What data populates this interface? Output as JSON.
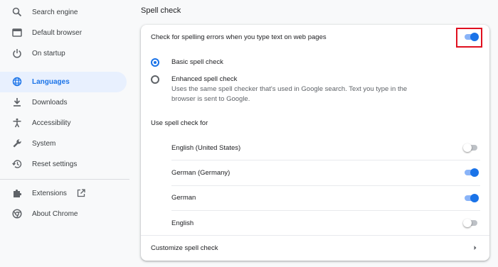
{
  "sidebar": {
    "items": [
      {
        "label": "Search engine",
        "icon": "search-icon"
      },
      {
        "label": "Default browser",
        "icon": "browser-window-icon"
      },
      {
        "label": "On startup",
        "icon": "power-icon"
      },
      {
        "label": "Languages",
        "icon": "globe-icon",
        "active": true
      },
      {
        "label": "Downloads",
        "icon": "download-icon"
      },
      {
        "label": "Accessibility",
        "icon": "accessibility-icon"
      },
      {
        "label": "System",
        "icon": "wrench-icon"
      },
      {
        "label": "Reset settings",
        "icon": "restore-icon"
      }
    ],
    "extra": [
      {
        "label": "Extensions",
        "icon": "puzzle-icon"
      },
      {
        "label": "About Chrome",
        "icon": "chrome-icon"
      }
    ]
  },
  "spell": {
    "title": "Spell check",
    "main_toggle_label": "Check for spelling errors when you type text on web pages",
    "main_toggle_on": true,
    "basic_label": "Basic spell check",
    "enhanced_label": "Enhanced spell check",
    "enhanced_desc_1": "Uses the same spell checker that's used in Google search. Text you type in the",
    "enhanced_desc_2": "browser is sent to Google.",
    "use_for_label": "Use spell check for",
    "languages": [
      {
        "name": "English (United States)",
        "enabled": false
      },
      {
        "name": "German (Germany)",
        "enabled": true
      },
      {
        "name": "German",
        "enabled": true
      },
      {
        "name": "English",
        "enabled": false
      }
    ],
    "customize_label": "Customize spell check"
  },
  "colors": {
    "accent": "#1a73e8",
    "active_bg": "#e8f0fe",
    "highlight_border": "#e0101f"
  }
}
